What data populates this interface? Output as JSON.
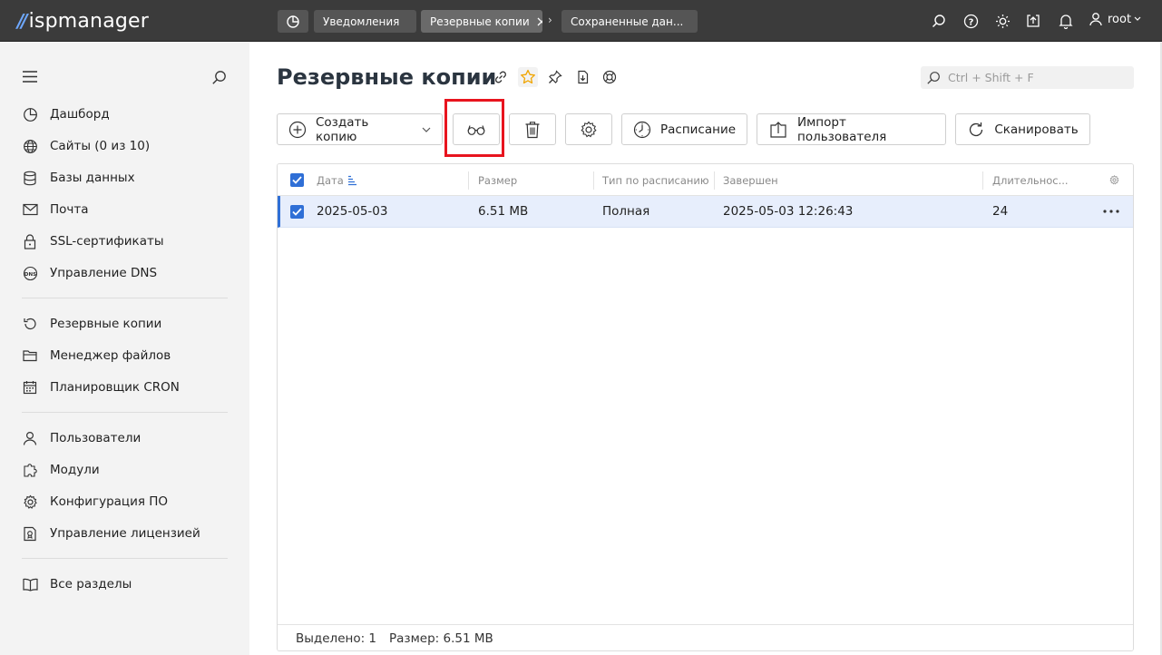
{
  "app": {
    "logo_text": "ispmanager"
  },
  "topbar": {
    "tabs": [
      {
        "label": "Уведомления"
      },
      {
        "label": "Резервные копии",
        "active": true
      },
      {
        "label": "Сохраненные дан..."
      }
    ],
    "separator": "›",
    "icons": [
      "search-icon",
      "help-icon",
      "theme-sun-icon",
      "upload-icon",
      "bell-icon",
      "user-icon"
    ],
    "user": "root"
  },
  "sidebar": {
    "groups": [
      [
        {
          "label": "Дашборд",
          "icon": "dashboard-icon"
        },
        {
          "label": "Сайты (0 из 10)",
          "icon": "globe-icon"
        },
        {
          "label": "Базы данных",
          "icon": "database-icon"
        },
        {
          "label": "Почта",
          "icon": "mail-icon"
        },
        {
          "label": "SSL-сертификаты",
          "icon": "lock-icon"
        },
        {
          "label": "Управление DNS",
          "icon": "dns-icon"
        }
      ],
      [
        {
          "label": "Резервные копии",
          "icon": "backup-icon"
        },
        {
          "label": "Менеджер файлов",
          "icon": "folder-icon"
        },
        {
          "label": "Планировщик CRON",
          "icon": "calendar-icon"
        }
      ],
      [
        {
          "label": "Пользователи",
          "icon": "user-icon"
        },
        {
          "label": "Модули",
          "icon": "puzzle-icon"
        },
        {
          "label": "Конфигурация ПО",
          "icon": "gear-icon"
        },
        {
          "label": "Управление лицензией",
          "icon": "license-icon"
        }
      ],
      [
        {
          "label": "Все разделы",
          "icon": "book-icon"
        }
      ]
    ]
  },
  "page": {
    "title": "Резервные копии",
    "search_placeholder": "Ctrl + Shift + F",
    "accent_color": "#2f6fd6",
    "highlight_color": "#e8141e"
  },
  "toolbar": {
    "create_label": "Создать копию",
    "schedule_label": "Расписание",
    "import_label": "Импорт пользователя",
    "scan_label": "Сканировать"
  },
  "table": {
    "columns": [
      "Дата",
      "Размер",
      "Тип по расписанию",
      "Завершен",
      "Длительнос..."
    ],
    "rows": [
      {
        "date": "2025-05-03",
        "size": "6.51 MB",
        "type": "Полная",
        "finished": "2025-05-03 12:26:43",
        "duration": "24",
        "selected": true
      }
    ],
    "footer": {
      "selected": "Выделено: 1",
      "size": "Размер: 6.51 MB"
    }
  }
}
